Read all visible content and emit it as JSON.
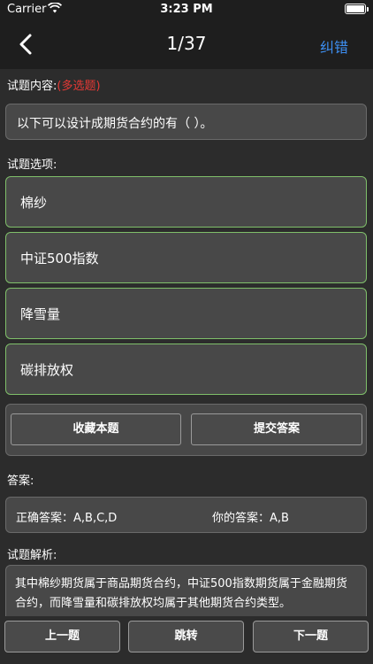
{
  "status_bar": {
    "carrier": "Carrier",
    "time": "3:23 PM"
  },
  "nav": {
    "title": "1/37",
    "report_label": "纠错"
  },
  "question": {
    "label": "试题内容:",
    "tag": "(多选题)",
    "text": "以下可以设计成期货合约的有（   ）。"
  },
  "options": {
    "label": "试题选项:",
    "items": [
      "棉纱",
      "中证500指数",
      "降雪量",
      "碳排放权"
    ]
  },
  "actions": {
    "favorite_label": "收藏本题",
    "submit_label": "提交答案"
  },
  "answer": {
    "label": "答案:",
    "correct_label": "正确答案：",
    "correct_value": "A,B,C,D",
    "yours_label": "你的答案：",
    "yours_value": "A,B"
  },
  "analysis": {
    "label": "试题解析:",
    "text": "其中棉纱期货属于商品期货合约，中证500指数期货属于金融期货合约，而降雪量和碳排放权均属于其他期货合约类型。"
  },
  "bottom": {
    "prev_label": "上一题",
    "jump_label": "跳转",
    "next_label": "下一题"
  },
  "colors": {
    "accent": "#3d8ef0",
    "tag": "#e53935",
    "option_border": "#7fbf6a"
  }
}
